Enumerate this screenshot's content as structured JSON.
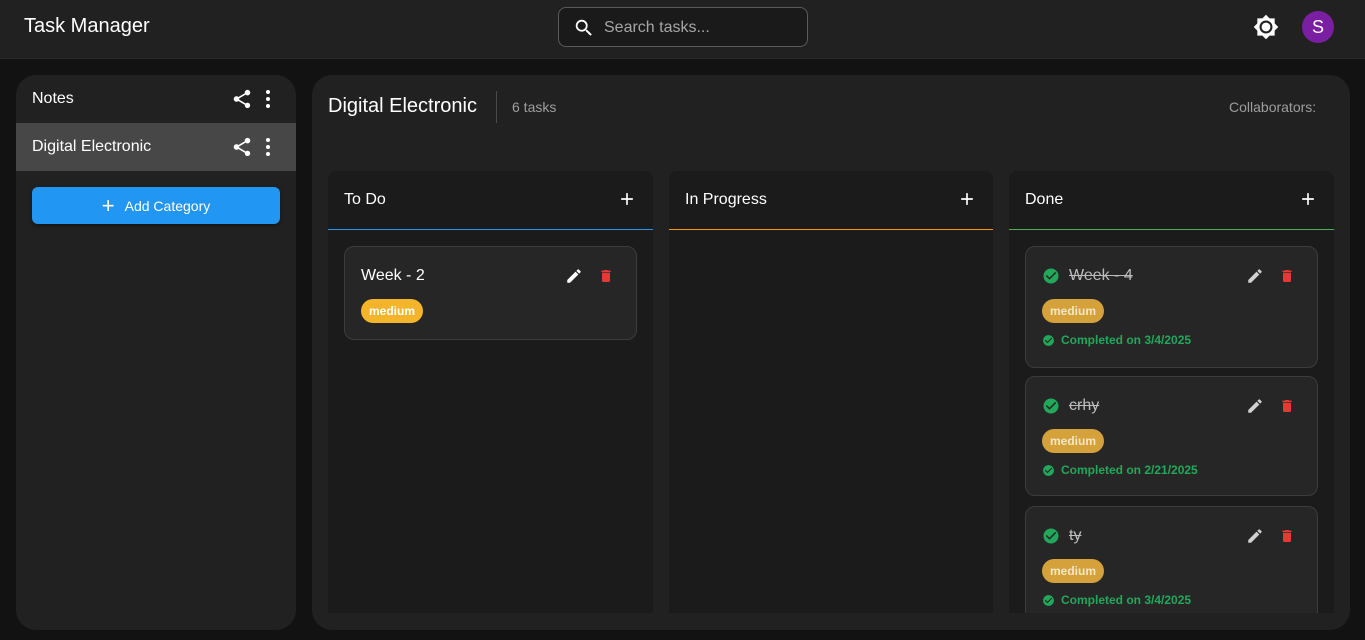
{
  "app": {
    "title": "Task Manager"
  },
  "search": {
    "placeholder": "Search tasks..."
  },
  "user": {
    "avatar_initial": "S",
    "avatar_color": "#7b1fa2"
  },
  "sidebar": {
    "categories": [
      {
        "label": "Notes",
        "active": false
      },
      {
        "label": "Digital Electronic",
        "active": true
      }
    ],
    "add_category_label": "Add Category"
  },
  "board": {
    "title": "Digital Electronic",
    "task_count": "6 tasks",
    "collaborators_label": "Collaborators:"
  },
  "columns": [
    {
      "title": "To Do",
      "accent": "#2196f3",
      "tasks": [
        {
          "title": "Week - 2",
          "priority": "medium",
          "done": false
        }
      ]
    },
    {
      "title": "In Progress",
      "accent": "#ff9800",
      "tasks": []
    },
    {
      "title": "Done",
      "accent": "#4caf50",
      "tasks": [
        {
          "title": "Week - 4",
          "priority": "medium",
          "done": true,
          "completed": "Completed on 3/4/2025"
        },
        {
          "title": "crhy",
          "priority": "medium",
          "done": true,
          "completed": "Completed on 2/21/2025"
        },
        {
          "title": "ty",
          "priority": "medium",
          "done": true,
          "completed": "Completed on 3/4/2025"
        }
      ]
    }
  ],
  "colors": {
    "primary": "#2196f3",
    "danger": "#e53935",
    "success": "#22a85a",
    "medium_badge": "#f5b52a"
  },
  "icons": [
    "search-icon",
    "brightness-icon",
    "share-icon",
    "more-vert-icon",
    "plus-icon",
    "edit-icon",
    "delete-icon",
    "check-circle-icon"
  ]
}
